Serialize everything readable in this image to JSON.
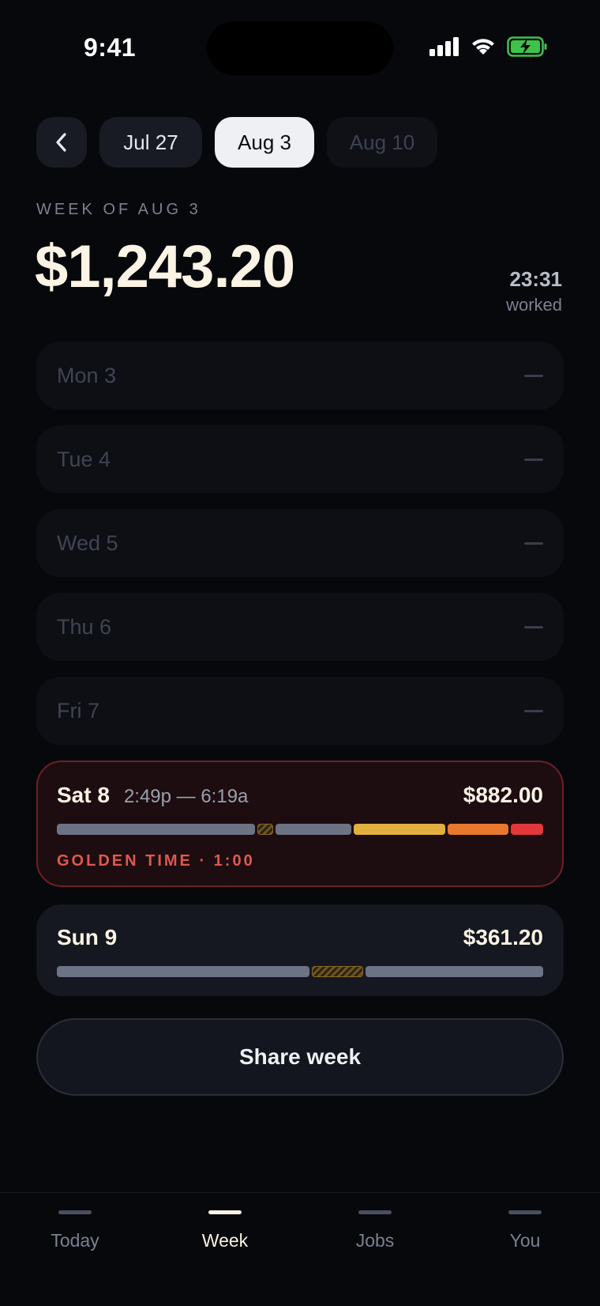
{
  "status": {
    "time": "9:41"
  },
  "week_nav": {
    "prev": "Jul 27",
    "current": "Aug 3",
    "next": "Aug 10"
  },
  "summary": {
    "week_label": "WEEK OF AUG 3",
    "total": "$1,243.20",
    "hours": "23:31",
    "hours_label": "worked"
  },
  "days": [
    {
      "name": "Mon 3"
    },
    {
      "name": "Tue 4"
    },
    {
      "name": "Wed 5"
    },
    {
      "name": "Thu 6"
    },
    {
      "name": "Fri 7"
    }
  ],
  "saturday": {
    "name": "Sat 8",
    "range": "2:49p — 6:19a",
    "amount": "$882.00",
    "golden_note": "GOLDEN TIME · 1:00"
  },
  "sunday": {
    "name": "Sun 9",
    "amount": "$361.20"
  },
  "share_label": "Share week",
  "tabs": [
    {
      "label": "Today"
    },
    {
      "label": "Week"
    },
    {
      "label": "Jobs"
    },
    {
      "label": "You"
    }
  ],
  "colors": {
    "accent": "#fbf3e4",
    "golden": "#e0584f",
    "gold_segment": "#e3b03f",
    "orange_segment": "#e8792c",
    "red_segment": "#e3373c",
    "battery": "#3fc24a"
  }
}
